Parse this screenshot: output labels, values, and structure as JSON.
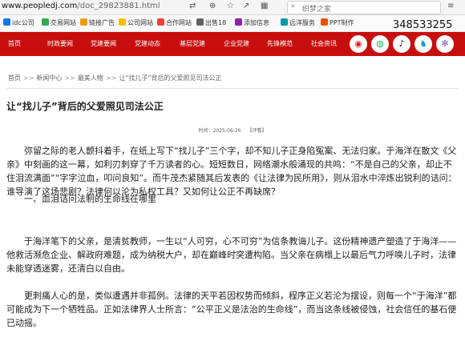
{
  "browser": {
    "url_domain": "www.peopledj.com",
    "url_path": "/doc_29823881.html",
    "search_placeholder": "织梦之家",
    "icons": [
      "translate-icon",
      "zoom-icon",
      "star-icon",
      "share-icon",
      "grid-icon",
      "search-icon",
      "menu-icon"
    ]
  },
  "bookmarks": [
    {
      "label": "idc公司",
      "color": "#1a73e8"
    },
    {
      "label": "交易网站",
      "color": "#34a853"
    },
    {
      "label": "链接广告",
      "color": "#f29900"
    },
    {
      "label": "公司网站",
      "color": "#fbbc04"
    },
    {
      "label": "合作网站",
      "color": "#ea4335"
    },
    {
      "label": "出售18",
      "color": "#5f6368"
    },
    {
      "label": "添加信息",
      "color": "#8e24aa"
    },
    {
      "label": "远洋服务",
      "color": "#0097a7"
    },
    {
      "label": "PPT制作",
      "color": "#e65100"
    }
  ],
  "overlay_number": "348533255",
  "nav": {
    "items": [
      "首页",
      "时政要闻",
      "党建要闻",
      "党建动态",
      "基层党建",
      "企业党建",
      "先锋模范",
      "社会资讯"
    ],
    "social": [
      {
        "name": "weibo-icon",
        "glyph": "◉",
        "color": "#e6162d"
      },
      {
        "name": "wechat-icon",
        "glyph": "◍",
        "color": "#2aae67"
      },
      {
        "name": "douyin-icon",
        "glyph": "♪",
        "color": "#222222"
      },
      {
        "name": "qq-icon",
        "glyph": "♞",
        "color": "#1296db"
      },
      {
        "name": "app-icon",
        "glyph": "✻",
        "color": "#7e57c2"
      }
    ]
  },
  "breadcrumb": {
    "home": "首页",
    "items": [
      "新闻中心",
      "最美人物",
      "让“找儿子”背后的父爱照见司法公正"
    ]
  },
  "article": {
    "title": "让“找儿子”背后的父爱照见司法公正",
    "time_label": "时间：",
    "date": "2025-06-26",
    "editor": "【评看】",
    "paragraphs": [
      "弥留之际的老人颤抖着手，在纸上写下“找儿子”三个字，却不知儿子正身陷冤案、无法归家。于海洋在散文《父亲》中刻画的这一幕，如利刃刺穿了千万读者的心。短短数日，网络潮水般涌现的共鸣：“不是自己的父亲，却止不住泪流满面”“字字泣血，叩问良知”。而牛茂杰紧随其后发表的《让法律为民所用》，则从泪水中淬炼出锐利的诘问：谁导演了这场悲剧？法律何以沦为私权工具？又如何让公正不再缺席？",
      "一、血泪诘问法制的生命线在哪里",
      "于海洋笔下的父亲，是清贫教师，一生以“人可穷，心不可穷”为信条教诲儿子。这份精神遗产塑造了于海洋——他救活濒危企业、解政府难题，成为纳税大户，却在巅峰时突遭构陷。当父亲在病榻上以最后气力呼唤儿子时，法律未能穿透迷雾，还清白以自由。",
      "更刺痛人心的是，类似遭遇并非孤例。法律的天平若因权势而倾斜，程序正义若沦为摆设，则每一个“于海洋”都可能成为下一个牺牲品。正如法律界人士所言：“公平正义是法治的生命线”，而当这条线被侵蚀，社会信任的基石便已动摇。"
    ]
  }
}
